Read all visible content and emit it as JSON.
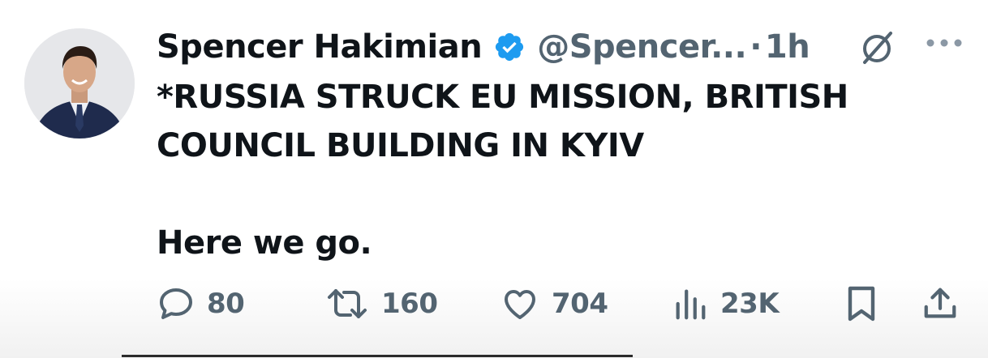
{
  "author": {
    "name": "Spencer Hakimian",
    "handle": "@Spencer...",
    "separator": "·",
    "time": "1h",
    "verified_icon": "verified-badge-icon",
    "verified_color": "#1d9bf0"
  },
  "tweet": {
    "lines": [
      "*RUSSIA STRUCK EU MISSION, BRITISH",
      "COUNCIL BUILDING IN KYIV",
      "Here we go."
    ]
  },
  "actions": {
    "replies": "80",
    "reposts": "160",
    "likes": "704",
    "views": "23K"
  },
  "icons": {
    "reply": "reply-icon",
    "repost": "repost-icon",
    "like": "heart-icon",
    "views": "views-icon",
    "bookmark": "bookmark-icon",
    "share": "share-icon",
    "grok": "grok-icon",
    "more": "more-icon"
  },
  "colors": {
    "text": "#0f1419",
    "secondary": "#536471",
    "accent": "#1d9bf0"
  }
}
